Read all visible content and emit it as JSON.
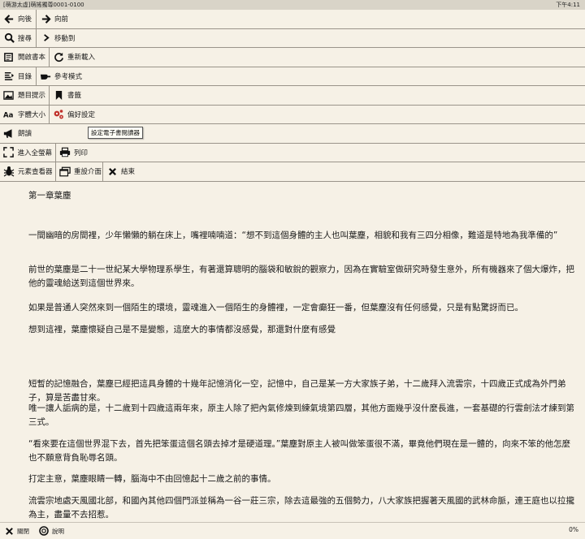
{
  "titlebar": {
    "title": "[萌游太虛]萌搖獨尊0001-0100",
    "time": "下午4:11"
  },
  "menu": {
    "rows": [
      [
        {
          "name": "back-button",
          "icon": "arrow-left-icon",
          "label": "向後",
          "w": 44
        },
        {
          "name": "forward-button",
          "icon": "arrow-right-icon",
          "label": "向前",
          "w": 0
        }
      ],
      [
        {
          "name": "search-button",
          "icon": "search-icon",
          "label": "搜尋",
          "w": 44
        },
        {
          "name": "goto-button",
          "icon": "chevron-right-icon",
          "label": "移動到",
          "w": 0
        }
      ],
      [
        {
          "name": "open-book-button",
          "icon": "book-icon",
          "label": "開啟書本",
          "w": 60
        },
        {
          "name": "reload-button",
          "icon": "refresh-icon",
          "label": "重新載入",
          "w": 0
        }
      ],
      [
        {
          "name": "toc-button",
          "icon": "list-icon",
          "label": "目錄",
          "w": 44
        },
        {
          "name": "reference-mode-button",
          "icon": "hand-point-icon",
          "label": "參考模式",
          "w": 0
        }
      ],
      [
        {
          "name": "image-tips-button",
          "icon": "image-icon",
          "label": "題目提示",
          "w": 60
        },
        {
          "name": "bookmark-button",
          "icon": "bookmark-icon",
          "label": "書籤",
          "w": 0
        }
      ],
      [
        {
          "name": "font-size-button",
          "icon": "font-size-icon",
          "label": "字體大小",
          "w": 60
        },
        {
          "name": "preferences-button",
          "icon": "gears-icon",
          "label": "偏好設定",
          "w": 0
        }
      ],
      [
        {
          "name": "read-aloud-button",
          "icon": "megaphone-icon",
          "label": "朗讀",
          "w": 0
        }
      ],
      [
        {
          "name": "fullscreen-button",
          "icon": "expand-icon",
          "label": "進入全螢幕",
          "w": 68
        },
        {
          "name": "print-button",
          "icon": "printer-icon",
          "label": "列印",
          "w": 0
        }
      ],
      [
        {
          "name": "inspector-button",
          "icon": "bug-icon",
          "label": "元素查看器",
          "w": 68
        },
        {
          "name": "reset-ui-button",
          "icon": "windows-icon",
          "label": "重設介面",
          "w": 58
        },
        {
          "name": "exit-button",
          "icon": "close-icon",
          "label": "結束",
          "w": 0
        }
      ]
    ],
    "tooltip": "設定電子書閱讀器"
  },
  "content": {
    "chapter_title": "第一章葉塵",
    "paragraphs": [
      "一間幽暗的房間裡，少年懶懶的躺在床上，嘴裡喃喃道：“想不到這個身體的主人也叫葉塵，相貌和我有三四分相像，難道是特地為我準備的”",
      "前世的葉塵是二十一世紀某大學物理系學生，有著還算聰明的腦袋和敏銳的觀察力，因為在實驗室做研究時發生意外，所有機器來了個大爆炸，把他的靈魂給送到這個世界來。",
      "如果是普通人突然來到一個陌生的環境，靈魂進入一個陌生的身體裡，一定會癲狂一番，但葉塵沒有任何感覺，只是有點驚訝而已。",
      "想到這裡，葉塵懷疑自己是不是變態，這麼大的事情都沒感覺，那還對什麼有感覺",
      "短暫的記憶融合，葉塵已經把這具身體的十幾年記憶消化一空，記憶中，自己是某一方大家族子弟，十二歲拜入流雲宗，十四歲正式成為外門弟子，算是苦盡甘來。",
      "唯一讓人詬病的是，十二歲到十四歲這兩年來，原主人除了把內氣修煉到練氣境第四層，其他方面幾乎沒什麼長進，一套基礎的行雲劍法才練到第三式。",
      "“看來要在這個世界混下去，首先把笨蛋這個名頭去掉才是硬道理。”葉塵對原主人被叫做笨蛋很不滿，畢竟他們現在是一體的，向來不笨的他怎麼也不願意背負恥辱名頭。",
      "打定主意，葉塵眼睛一轉，腦海中不由回憶起十二歲之前的事情。",
      "流雲宗地處天風國北部，和國內其他四個門派並稱為一谷一莊三宗，除去這最強的五個勢力，八大家族把握著天風國的武林命脈，連王庭也以拉攏為主，盡量不去招惹。"
    ]
  },
  "bottombar": {
    "close_label": "關閉",
    "help_label": "說明",
    "progress": "0%"
  }
}
